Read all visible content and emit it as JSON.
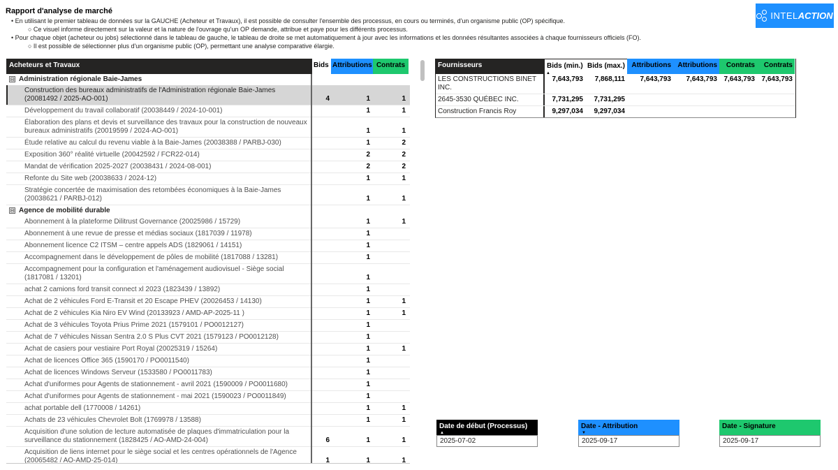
{
  "header": {
    "title": "Rapport d'analyse de marché",
    "bullets": [
      {
        "level": 1,
        "text": "• En utilisant le premier tableau de données sur la GAUCHE (Acheteur et Travaux), il est possible de consulter l'ensemble des processus, en cours ou terminés, d'un organisme public (OP) spécifique."
      },
      {
        "level": 2,
        "text": "○ Ce visuel informe directement sur la valeur et la nature de l'ouvrage qu'un OP demande, attribue et paye pour les différents processus."
      },
      {
        "level": 1,
        "text": "• Pour chaque objet (acheteur ou jobs) sélectionné dans le tableau de gauche, le tableau de droite se met automatiquement à jour avec les informations et les données résultantes associées à chaque fournisseurs officiels (FO)."
      },
      {
        "level": 2,
        "text": "○ Il est possible de sélectionner plus d'un organisme public (OP), permettant une analyse comparative élargie."
      }
    ]
  },
  "logo": {
    "part1": "INTEL",
    "part2": "ACTION",
    "color": "#1e90ff"
  },
  "left_table": {
    "headers": {
      "name": "Acheteurs et Travaux",
      "bids": "Bids",
      "attributions": "Attributions",
      "contrats": "Contrats"
    },
    "rows": [
      {
        "type": "group",
        "name": "Administration régionale Baie-James",
        "expander": "⊟",
        "bids": "",
        "attr": "",
        "cont": ""
      },
      {
        "type": "item",
        "selected": true,
        "name": "Construction des bureaux administratifs de l'Administration régionale Baie-James (20081492 / 2025-AO-001)",
        "bids": "4",
        "attr": "1",
        "cont": "1"
      },
      {
        "type": "item",
        "name": "Développement du travail collaboratif (20038449 / 2024-10-001)",
        "bids": "",
        "attr": "1",
        "cont": "1"
      },
      {
        "type": "item",
        "name": "Élaboration des plans et devis et surveillance des travaux pour la construction de nouveaux bureaux administratifs (20019599 / 2024-AO-001)",
        "bids": "",
        "attr": "1",
        "cont": "1"
      },
      {
        "type": "item",
        "name": "Étude relative au calcul du revenu viable à la Baie-James (20038388 / PARBJ-030)",
        "bids": "",
        "attr": "1",
        "cont": "2"
      },
      {
        "type": "item",
        "name": "Exposition 360° réalité virtuelle (20042592 / FCR22-014)",
        "bids": "",
        "attr": "2",
        "cont": "2"
      },
      {
        "type": "item",
        "name": "Mandat de vérification 2025-2027 (20038431 / 2024-08-001)",
        "bids": "",
        "attr": "2",
        "cont": "2"
      },
      {
        "type": "item",
        "name": "Refonte du Site web (20038633 / 2024-12)",
        "bids": "",
        "attr": "1",
        "cont": "1"
      },
      {
        "type": "item",
        "name": "Stratégie concertée de maximisation des retombées économiques à la Baie-James (20038621 / PARBJ-012)",
        "bids": "",
        "attr": "1",
        "cont": "1"
      },
      {
        "type": "group",
        "name": "Agence de mobilité durable",
        "expander": "⊟",
        "bids": "",
        "attr": "",
        "cont": ""
      },
      {
        "type": "item",
        "name": "Abonnement à la plateforme Dilitrust Governance (20025986 / 15729)",
        "bids": "",
        "attr": "1",
        "cont": "1"
      },
      {
        "type": "item",
        "name": "Abonnement à une revue de presse et médias sociaux (1817039 / 11978)",
        "bids": "",
        "attr": "1",
        "cont": ""
      },
      {
        "type": "item",
        "name": "Abonnement licence C2 ITSM – centre appels ADS (1829061 / 14151)",
        "bids": "",
        "attr": "1",
        "cont": ""
      },
      {
        "type": "item",
        "name": "Accompagnement dans le développement de pôles de mobilité (1817088 / 13281)",
        "bids": "",
        "attr": "1",
        "cont": ""
      },
      {
        "type": "item",
        "name": "Accompagnement pour la configuration et l'aménagement audiovisuel - Siège social (1817081 / 13201)",
        "bids": "",
        "attr": "1",
        "cont": ""
      },
      {
        "type": "item",
        "name": "achat 2 camions ford transit connect xl 2023 (1823439 / 13892)",
        "bids": "",
        "attr": "1",
        "cont": ""
      },
      {
        "type": "item",
        "name": "Achat de 2 véhicules Ford E-Transit et 20 Escape PHEV (20026453 / 14130)",
        "bids": "",
        "attr": "1",
        "cont": "1"
      },
      {
        "type": "item",
        "name": "Achat de 2 véhicules Kia Niro EV Wind (20133923 / AMD-AP-2025-11 )",
        "bids": "",
        "attr": "1",
        "cont": "1"
      },
      {
        "type": "item",
        "name": "Achat de 3 véhicules Toyota Prius Prime 2021 (1579101 / PO0012127)",
        "bids": "",
        "attr": "1",
        "cont": ""
      },
      {
        "type": "item",
        "name": "Achat de 7 véhicules Nissan Sentra 2.0 S Plus CVT 2021 (1579123 / PO0012128)",
        "bids": "",
        "attr": "1",
        "cont": ""
      },
      {
        "type": "item",
        "name": "Achat de casiers pour vestiaire Port Royal (20025319 / 15264)",
        "bids": "",
        "attr": "1",
        "cont": "1"
      },
      {
        "type": "item",
        "name": "Achat de licences Office 365 (1590170 / PO0011540)",
        "bids": "",
        "attr": "1",
        "cont": ""
      },
      {
        "type": "item",
        "name": "Achat de licences Windows Serveur (1533580 / PO0011783)",
        "bids": "",
        "attr": "1",
        "cont": ""
      },
      {
        "type": "item",
        "name": "Achat d'uniformes pour Agents de stationnement - avril 2021 (1590009 / PO0011680)",
        "bids": "",
        "attr": "1",
        "cont": ""
      },
      {
        "type": "item",
        "name": "Achat d'uniformes pour Agents de stationnement - mai 2021 (1590023 / PO0011849)",
        "bids": "",
        "attr": "1",
        "cont": ""
      },
      {
        "type": "item",
        "name": "achat portable dell (1770008 / 14261)",
        "bids": "",
        "attr": "1",
        "cont": "1"
      },
      {
        "type": "item",
        "name": "Achats de 23 véhicules Chevrolet Bolt (1769978 / 13588)",
        "bids": "",
        "attr": "1",
        "cont": "1"
      },
      {
        "type": "item",
        "name": "Acquisition d'une solution de lecture automatisée de plaques d'immatriculation pour la surveillance du stationnement (1828425 / AO-AMD-24-004)",
        "bids": "6",
        "attr": "1",
        "cont": "1"
      },
      {
        "type": "item",
        "name": "Acquisition de liens internet pour le siège social et les centres opérationnels de l'Agence (20065482 / AO-AMD-25-014)",
        "bids": "1",
        "attr": "1",
        "cont": "1"
      }
    ]
  },
  "right_table": {
    "headers": {
      "fournisseurs": "Fournisseurs",
      "bids_min": "Bids (min.)",
      "bids_max": "Bids (max.)",
      "attr1": "Attributions",
      "attr2": "Attributions",
      "cont1": "Contrats",
      "cont2": "Contrats"
    },
    "rows": [
      {
        "name": "LES CONSTRUCTIONS BINET INC.",
        "bids_min": "7,643,793",
        "bids_max": "7,868,111",
        "attr1": "7,643,793",
        "attr2": "7,643,793",
        "cont1": "7,643,793",
        "cont2": "7,643,793"
      },
      {
        "name": "2645-3530 QUÉBEC INC.",
        "bids_min": "7,731,295",
        "bids_max": "7,731,295",
        "attr1": "",
        "attr2": "",
        "cont1": "",
        "cont2": ""
      },
      {
        "name": "Construction Francis Roy",
        "bids_min": "9,297,034",
        "bids_max": "9,297,034",
        "attr1": "",
        "attr2": "",
        "cont1": "",
        "cont2": ""
      }
    ]
  },
  "date_cards": {
    "start": {
      "label": "Date de début (Processus)",
      "value": "2025-07-02"
    },
    "attribution": {
      "label": "Date - Attribution",
      "value": "2025-09-17"
    },
    "signature": {
      "label": "Date - Signature",
      "value": "2025-09-17"
    }
  },
  "colors": {
    "dark": "#252423",
    "blue": "#1e90ff",
    "green": "#1ec86e"
  }
}
